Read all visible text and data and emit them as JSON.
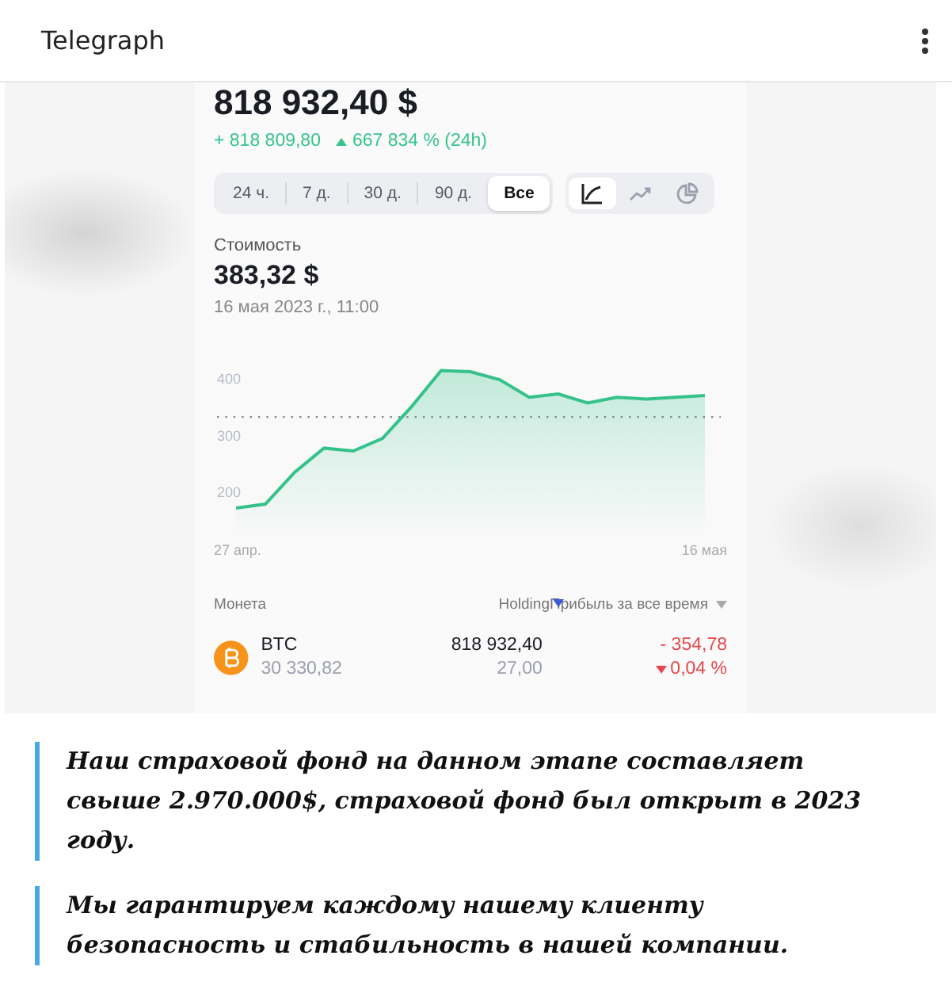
{
  "header": {
    "title": "Telegraph"
  },
  "portfolio": {
    "total": "818 932,40 $",
    "change": "+ 818 809,80",
    "change_pct": "667 834 % (24h)"
  },
  "periods": [
    {
      "label": "24 ч.",
      "selected": false
    },
    {
      "label": "7 д.",
      "selected": false
    },
    {
      "label": "30 д.",
      "selected": false
    },
    {
      "label": "90 д.",
      "selected": false
    },
    {
      "label": "Все",
      "selected": true
    }
  ],
  "chart_modes": [
    {
      "kind": "line",
      "selected": true
    },
    {
      "kind": "trend",
      "selected": false
    },
    {
      "kind": "pie",
      "selected": false
    }
  ],
  "value": {
    "label": "Стоимость",
    "amount": "383,32 $",
    "date": "16 мая 2023 г., 11:00"
  },
  "chart_data": {
    "type": "area",
    "categories": [
      "27 апр.",
      null,
      null,
      null,
      null,
      null,
      null,
      null,
      null,
      null,
      null,
      null,
      null,
      null,
      null,
      null,
      "16 мая"
    ],
    "series": [
      {
        "color": "#34c28a",
        "values": [
          169,
          176,
          232,
          275,
          270,
          292,
          349,
          412,
          410,
          396,
          365,
          371,
          355,
          365,
          362,
          365,
          368
        ]
      }
    ],
    "ylim": [
      120,
      490
    ],
    "yticks": [
      200,
      300,
      400
    ],
    "ref_lines": [
      {
        "axis": "y",
        "value": 330
      }
    ]
  },
  "table": {
    "columns": [
      "Монета",
      "Holding",
      "Прибыль за все время"
    ],
    "rows": [
      {
        "symbol": "BTC",
        "price": "30 330,82",
        "holding": "818 932,40",
        "amount": "27,00",
        "profit": "- 354,78",
        "profit_pct": "0,04 %"
      }
    ]
  },
  "quotes": [
    "Наш страховой фонд на данном этапе составляет свыше 2.970.000$, страховой фонд был открыт в 2023 году.",
    "Мы гарантируем каждому нашему клиенту безопасность и стабильность в нашей компании."
  ]
}
